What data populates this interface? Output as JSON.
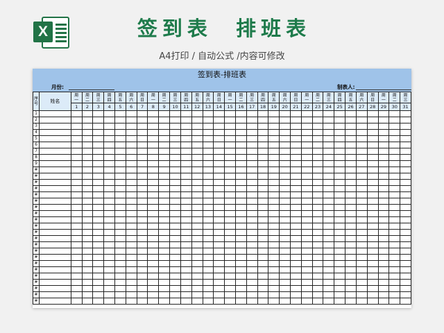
{
  "header": {
    "logo_letter": "X",
    "title": "签到表  排班表",
    "subtitle": "A4打印 / 自动公式 /内容可修改"
  },
  "sheet": {
    "title": "签到表-排班表",
    "month_label": "月份:",
    "maker_label": "制表人:",
    "col_seq": "序号",
    "col_name": "姓名",
    "days": [
      {
        "w": "一",
        "n": "1"
      },
      {
        "w": "二",
        "n": "2"
      },
      {
        "w": "三",
        "n": "3"
      },
      {
        "w": "四",
        "n": "4"
      },
      {
        "w": "五",
        "n": "5"
      },
      {
        "w": "六",
        "n": "6"
      },
      {
        "w": "日",
        "n": "7"
      },
      {
        "w": "一",
        "n": "8"
      },
      {
        "w": "二",
        "n": "9"
      },
      {
        "w": "三",
        "n": "10"
      },
      {
        "w": "四",
        "n": "11"
      },
      {
        "w": "五",
        "n": "12"
      },
      {
        "w": "六",
        "n": "13"
      },
      {
        "w": "日",
        "n": "14"
      },
      {
        "w": "一",
        "n": "15"
      },
      {
        "w": "二",
        "n": "16"
      },
      {
        "w": "三",
        "n": "17"
      },
      {
        "w": "四",
        "n": "18"
      },
      {
        "w": "五",
        "n": "19"
      },
      {
        "w": "六",
        "n": "20"
      },
      {
        "w": "日",
        "n": "21"
      },
      {
        "w": "一",
        "n": "22"
      },
      {
        "w": "二",
        "n": "23"
      },
      {
        "w": "三",
        "n": "24"
      },
      {
        "w": "四",
        "n": "25"
      },
      {
        "w": "五",
        "n": "26"
      },
      {
        "w": "六",
        "n": "27"
      },
      {
        "w": "日",
        "n": "28"
      },
      {
        "w": "一",
        "n": "29"
      },
      {
        "w": "二",
        "n": "30"
      },
      {
        "w": "三",
        "n": "31"
      }
    ],
    "week_prefix": "周",
    "row_labels": [
      "1",
      "2",
      "3",
      "4",
      "5",
      "6",
      "7",
      "8",
      "9",
      "#",
      "#",
      "#",
      "#",
      "#",
      "#",
      "#",
      "#",
      "#",
      "#",
      "#",
      "#",
      "#",
      "#",
      "#",
      "#",
      "#",
      "#",
      "#",
      "#",
      "#",
      "#"
    ]
  }
}
